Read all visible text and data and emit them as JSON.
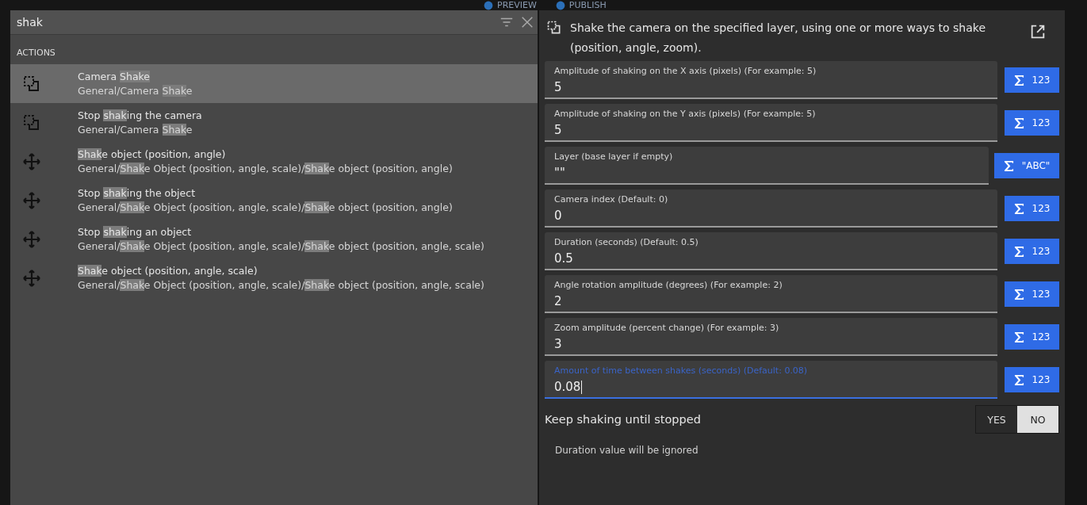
{
  "toolbar": {
    "items": [
      {
        "label": "PREVIEW"
      },
      {
        "label": "PUBLISH"
      }
    ]
  },
  "search": {
    "value": "shak"
  },
  "results": {
    "section": "ACTIONS",
    "items": [
      {
        "kind": "camera",
        "selected": true,
        "title": [
          {
            "text": "Camera "
          },
          {
            "text": "Shake",
            "match": true
          }
        ],
        "path": [
          {
            "text": "General/Camera "
          },
          {
            "text": "Shak",
            "match": true
          },
          {
            "text": "e"
          }
        ]
      },
      {
        "kind": "camera",
        "selected": false,
        "title": [
          {
            "text": "Stop "
          },
          {
            "text": "shak",
            "match": true
          },
          {
            "text": "ing the camera"
          }
        ],
        "path": [
          {
            "text": "General/Camera "
          },
          {
            "text": "Shak",
            "match": true
          },
          {
            "text": "e"
          }
        ]
      },
      {
        "kind": "object",
        "selected": false,
        "title": [
          {
            "text": "Shak",
            "match": true
          },
          {
            "text": "e object (position, angle)"
          }
        ],
        "path": [
          {
            "text": "General/"
          },
          {
            "text": "Shak",
            "match": true
          },
          {
            "text": "e Object (position, angle, scale)/"
          },
          {
            "text": "Shak",
            "match": true
          },
          {
            "text": "e object (position, angle)"
          }
        ]
      },
      {
        "kind": "object",
        "selected": false,
        "title": [
          {
            "text": "Stop "
          },
          {
            "text": "shak",
            "match": true
          },
          {
            "text": "ing the object"
          }
        ],
        "path": [
          {
            "text": "General/"
          },
          {
            "text": "Shak",
            "match": true
          },
          {
            "text": "e Object (position, angle, scale)/"
          },
          {
            "text": "Shak",
            "match": true
          },
          {
            "text": "e object (position, angle)"
          }
        ]
      },
      {
        "kind": "object",
        "selected": false,
        "title": [
          {
            "text": "Stop "
          },
          {
            "text": "shak",
            "match": true
          },
          {
            "text": "ing an object"
          }
        ],
        "path": [
          {
            "text": "General/"
          },
          {
            "text": "Shak",
            "match": true
          },
          {
            "text": "e Object (position, angle, scale)/"
          },
          {
            "text": "Shak",
            "match": true
          },
          {
            "text": "e object (position, angle, scale)"
          }
        ]
      },
      {
        "kind": "object",
        "selected": false,
        "title": [
          {
            "text": "Shak",
            "match": true
          },
          {
            "text": "e object (position, angle, scale)"
          }
        ],
        "path": [
          {
            "text": "General/"
          },
          {
            "text": "Shak",
            "match": true
          },
          {
            "text": "e Object (position, angle, scale)/"
          },
          {
            "text": "Shak",
            "match": true
          },
          {
            "text": "e object (position, angle, scale)"
          }
        ]
      }
    ]
  },
  "details": {
    "description": "Shake the camera on the specified layer, using one or more ways to shake (position, angle, zoom).",
    "parameters": [
      {
        "label": "Amplitude of shaking on the X axis (pixels) (For example: 5)",
        "value": "5",
        "focused": false,
        "button": {
          "kind": "number",
          "label": "123"
        }
      },
      {
        "label": "Amplitude of shaking on the Y axis (pixels) (For example: 5)",
        "value": "5",
        "focused": false,
        "button": {
          "kind": "number",
          "label": "123"
        }
      },
      {
        "label": "Layer (base layer if empty)",
        "value": "\"\"",
        "focused": false,
        "button": {
          "kind": "string",
          "label": "\"ABC\""
        }
      },
      {
        "label": "Camera index (Default: 0)",
        "value": "0",
        "focused": false,
        "button": {
          "kind": "number",
          "label": "123"
        }
      },
      {
        "label": "Duration (seconds) (Default: 0.5)",
        "value": "0.5",
        "focused": false,
        "button": {
          "kind": "number",
          "label": "123"
        }
      },
      {
        "label": "Angle rotation amplitude (degrees) (For example: 2)",
        "value": "2",
        "focused": false,
        "button": {
          "kind": "number",
          "label": "123"
        }
      },
      {
        "label": "Zoom amplitude (percent change) (For example: 3)",
        "value": "3",
        "focused": false,
        "button": {
          "kind": "number",
          "label": "123"
        }
      },
      {
        "label": "Amount of time between shakes (seconds) (Default: 0.08)",
        "value": "0.08",
        "focused": true,
        "button": {
          "kind": "number",
          "label": "123"
        }
      }
    ],
    "toggle": {
      "label": "Keep shaking until stopped",
      "options": [
        {
          "label": "YES",
          "selected": false
        },
        {
          "label": "NO",
          "selected": true
        }
      ]
    },
    "hint": "Duration value will be ignored"
  }
}
